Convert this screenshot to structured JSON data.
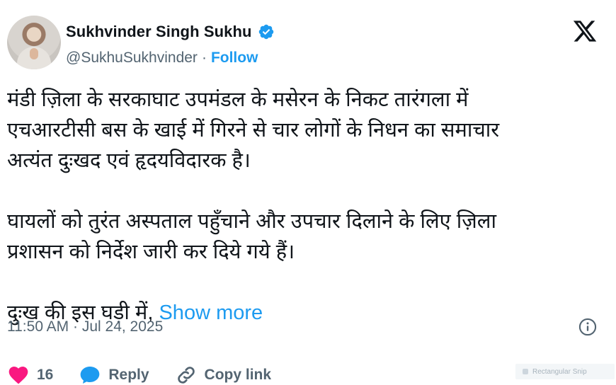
{
  "author": {
    "name": "Sukhvinder Singh Sukhu",
    "handle": "@SukhuSukhvinder",
    "separator": "·",
    "follow_label": "Follow"
  },
  "tweet": {
    "lines": [
      "मंडी ज़िला के सरकाघाट उपमंडल के मसेरन के निकट तारंगला में",
      "एचआरटीसी बस के खाई में गिरने से चार लोगों के निधन का समाचार",
      "अत्यंत दुःखद एवं हृदयविदारक है।",
      "घायलों को तुरंत अस्पताल पहुँचाने और उपचार दिलाने के लिए  ज़िला",
      "प्रशासन को निर्देश जारी कर दिये गये हैं।",
      "दुःख की इस घड़ी में,"
    ],
    "show_more_label": "Show more",
    "timestamp": "11:50 AM · Jul 24, 2025"
  },
  "actions": {
    "like_count": "16",
    "reply_label": "Reply",
    "copy_link_label": "Copy link"
  },
  "overlay": {
    "snip_label": "Rectangular Snip"
  },
  "colors": {
    "accent": "#1d9bf0",
    "like": "#f91880",
    "text": "#0f1419",
    "muted": "#536471"
  },
  "icons": {
    "verified": "verified-badge-icon",
    "logo": "x-logo-icon",
    "info": "info-icon",
    "like": "heart-icon",
    "reply": "reply-bubble-icon",
    "copy": "link-icon"
  }
}
